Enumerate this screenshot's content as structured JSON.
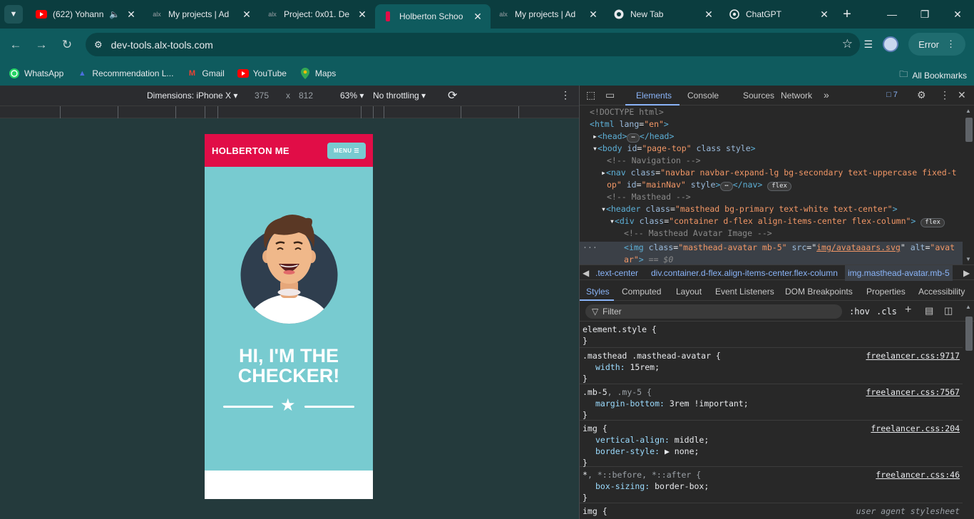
{
  "browser": {
    "tabs": [
      {
        "title": "(622) Yohann",
        "favicon": "youtube-icon",
        "audio": true,
        "active": false
      },
      {
        "title": "My projects | Ad",
        "favicon": "alx-icon",
        "active": false
      },
      {
        "title": "Project: 0x01. De",
        "favicon": "alx-icon",
        "active": false
      },
      {
        "title": "Holberton Schoo",
        "favicon": "holberton-icon",
        "active": true
      },
      {
        "title": "My projects | Ad",
        "favicon": "alx-icon",
        "active": false
      },
      {
        "title": "New Tab",
        "favicon": "chrome-icon",
        "active": false
      },
      {
        "title": "ChatGPT",
        "favicon": "chatgpt-icon",
        "active": false
      }
    ],
    "url": "dev-tools.alx-tools.com",
    "profile_status": "Error",
    "bookmarks": [
      {
        "label": "WhatsApp",
        "icon": "whatsapp-icon"
      },
      {
        "label": "Recommendation L...",
        "icon": "bookmark-icon"
      },
      {
        "label": "Gmail",
        "icon": "gmail-icon"
      },
      {
        "label": "YouTube",
        "icon": "youtube-icon"
      },
      {
        "label": "Maps",
        "icon": "maps-icon"
      }
    ],
    "all_bookmarks": "All Bookmarks"
  },
  "device_bar": {
    "dimensions_label": "Dimensions: iPhone X",
    "width": "375",
    "times": "x",
    "height": "812",
    "zoom": "63%",
    "throttling": "No throttling"
  },
  "page": {
    "brand": "HOLBERTON ME",
    "menu_label": "MENU",
    "heading_line1": "HI, I'M THE",
    "heading_line2": "CHECKER!"
  },
  "devtools": {
    "tabs": [
      "Elements",
      "Console",
      "Sources",
      "Network"
    ],
    "active_tab": "Elements",
    "issues_count": "7",
    "dom": {
      "doctype": "<!DOCTYPE html>",
      "html_tag": "html",
      "html_lang_attr": "lang",
      "html_lang_val": "\"en\"",
      "head": "<head>",
      "head_close": "</head>",
      "body_tag": "body",
      "body_attr_id": "id",
      "body_val_id": "\"page-top\"",
      "body_attrs_rest": "class style",
      "comment_nav": "<!-- Navigation -->",
      "nav_tag": "nav",
      "nav_attr_class": "class",
      "nav_val_class_1": "\"navbar navbar-expand-lg bg-secondary text-uppercase fixed-t",
      "nav_val_class_2": "op\"",
      "nav_attr_id": "id",
      "nav_val_id": "\"mainNav\"",
      "nav_attr_style": "style",
      "nav_close": "</nav>",
      "comment_masthead": "<!-- Masthead -->",
      "header_tag": "header",
      "header_attr": "class",
      "header_val": "\"masthead bg-primary text-white text-center\"",
      "div_tag": "div",
      "div_attr": "class",
      "div_val": "\"container d-flex align-items-center flex-column\"",
      "comment_avatar": "<!-- Masthead Avatar Image -->",
      "img_tag": "img",
      "img_attr_class": "class",
      "img_val_class": "\"masthead-avatar mb-5\"",
      "img_attr_src": "src",
      "img_val_src": "img/avataaars.svg",
      "img_attr_alt": "alt",
      "img_val_alt_1": "\"avat",
      "img_val_alt_2": "ar\"",
      "dollar": "== $0",
      "flex_badge": "flex",
      "ellipsis": "⋯"
    },
    "breadcrumbs": [
      ".text-center",
      "div.container.d-flex.align-items-center.flex-column",
      "img.masthead-avatar.mb-5"
    ],
    "sub_tabs": [
      "Styles",
      "Computed",
      "Layout",
      "Event Listeners",
      "DOM Breakpoints",
      "Properties",
      "Accessibility"
    ],
    "filter_placeholder": "Filter",
    "hov": ":hov",
    "cls": ".cls",
    "styles": [
      {
        "selector": "element.style {",
        "source": "",
        "props": [],
        "close": "}"
      },
      {
        "selector": ".masthead .masthead-avatar {",
        "source": "freelancer.css:9717",
        "props": [
          {
            "name": "width",
            "value": "15rem;"
          }
        ],
        "close": "}"
      },
      {
        "selector": ".mb-5",
        "selector_dim": ", .my-5 {",
        "source": "freelancer.css:7567",
        "props": [
          {
            "name": "margin-bottom",
            "value": "3rem !important;"
          }
        ],
        "close": "}"
      },
      {
        "selector": "img {",
        "source": "freelancer.css:204",
        "props": [
          {
            "name": "vertical-align",
            "value": "middle;"
          },
          {
            "name": "border-style",
            "value": "▶ none;"
          }
        ],
        "close": "}"
      },
      {
        "selector": "*",
        "selector_dim": ", *::before, *::after {",
        "source": "freelancer.css:46",
        "props": [
          {
            "name": "box-sizing",
            "value": "border-box;"
          }
        ],
        "close": "}"
      },
      {
        "selector": "img {",
        "source": "user agent stylesheet",
        "props": [],
        "close": ""
      }
    ]
  }
}
